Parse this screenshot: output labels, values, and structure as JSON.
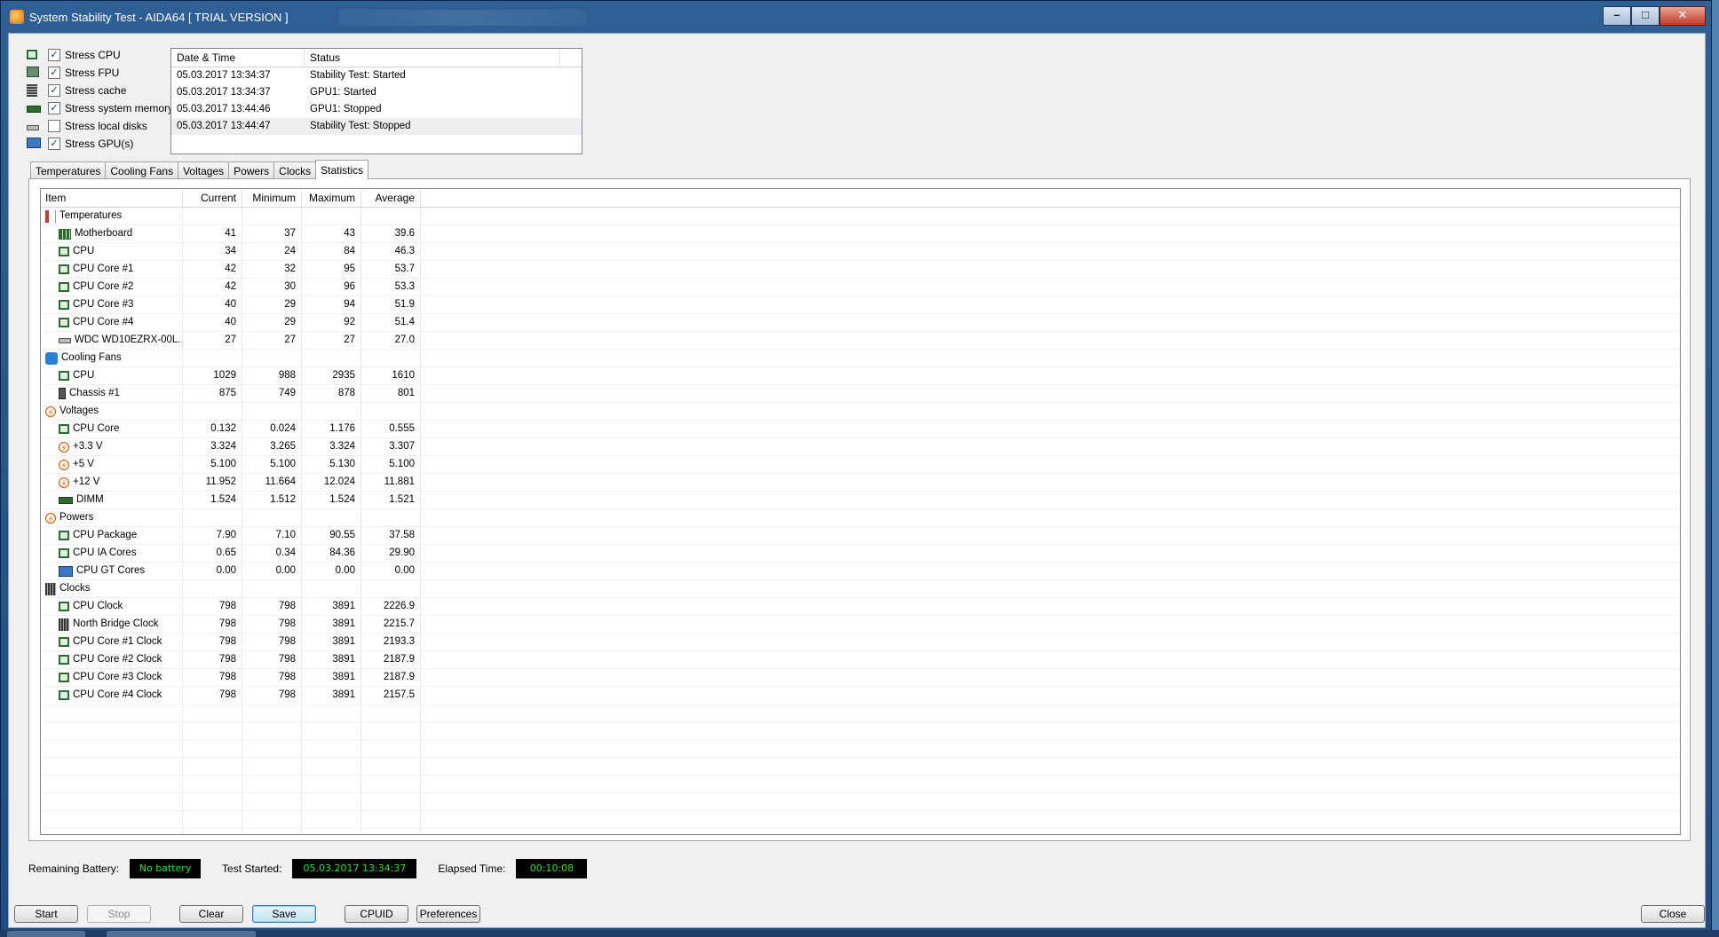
{
  "window": {
    "title": "System Stability Test - AIDA64  [ TRIAL VERSION ]",
    "caption_buttons": {
      "minimize": "–",
      "maximize": "□",
      "close": "✕"
    }
  },
  "stress": [
    {
      "label": "Stress CPU",
      "checked": true,
      "icon": "cpu-chip-icon"
    },
    {
      "label": "Stress FPU",
      "checked": true,
      "icon": "fpu-icon"
    },
    {
      "label": "Stress cache",
      "checked": true,
      "icon": "cache-icon"
    },
    {
      "label": "Stress system memory",
      "checked": true,
      "icon": "memory-icon"
    },
    {
      "label": "Stress local disks",
      "checked": false,
      "icon": "disk-icon"
    },
    {
      "label": "Stress GPU(s)",
      "checked": true,
      "icon": "gpu-icon"
    }
  ],
  "log": {
    "columns": [
      "Date & Time",
      "Status"
    ],
    "rows": [
      {
        "time": "05.03.2017 13:34:37",
        "status": "Stability Test: Started"
      },
      {
        "time": "05.03.2017 13:34:37",
        "status": "GPU1: Started"
      },
      {
        "time": "05.03.2017 13:44:46",
        "status": "GPU1: Stopped"
      },
      {
        "time": "05.03.2017 13:44:47",
        "status": "Stability Test: Stopped"
      }
    ]
  },
  "tabs": [
    "Temperatures",
    "Cooling Fans",
    "Voltages",
    "Powers",
    "Clocks",
    "Statistics"
  ],
  "active_tab": "Statistics",
  "stats": {
    "columns": [
      "Item",
      "Current",
      "Minimum",
      "Maximum",
      "Average"
    ],
    "rows": [
      {
        "type": "group",
        "icon": "thermometer-icon",
        "item": "Temperatures"
      },
      {
        "type": "child",
        "icon": "motherboard-icon",
        "item": "Motherboard",
        "cur": "41",
        "min": "37",
        "max": "43",
        "avg": "39.6"
      },
      {
        "type": "child",
        "icon": "cpu-chip-icon",
        "item": "CPU",
        "cur": "34",
        "min": "24",
        "max": "84",
        "avg": "46.3"
      },
      {
        "type": "child",
        "icon": "cpu-chip-icon",
        "item": "CPU Core #1",
        "cur": "42",
        "min": "32",
        "max": "95",
        "avg": "53.7"
      },
      {
        "type": "child",
        "icon": "cpu-chip-icon",
        "item": "CPU Core #2",
        "cur": "42",
        "min": "30",
        "max": "96",
        "avg": "53.3"
      },
      {
        "type": "child",
        "icon": "cpu-chip-icon",
        "item": "CPU Core #3",
        "cur": "40",
        "min": "29",
        "max": "94",
        "avg": "51.9"
      },
      {
        "type": "child",
        "icon": "cpu-chip-icon",
        "item": "CPU Core #4",
        "cur": "40",
        "min": "29",
        "max": "92",
        "avg": "51.4"
      },
      {
        "type": "child",
        "icon": "disk-icon",
        "item": "WDC WD10EZRX-00L...",
        "cur": "27",
        "min": "27",
        "max": "27",
        "avg": "27.0"
      },
      {
        "type": "group",
        "icon": "fan-icon",
        "item": "Cooling Fans"
      },
      {
        "type": "child",
        "icon": "cpu-chip-icon",
        "item": "CPU",
        "cur": "1029",
        "min": "988",
        "max": "2935",
        "avg": "1610"
      },
      {
        "type": "child",
        "icon": "chassis-icon",
        "item": "Chassis #1",
        "cur": "875",
        "min": "749",
        "max": "878",
        "avg": "801"
      },
      {
        "type": "group",
        "icon": "voltage-icon",
        "item": "Voltages"
      },
      {
        "type": "child",
        "icon": "cpu-chip-icon",
        "item": "CPU Core",
        "cur": "0.132",
        "min": "0.024",
        "max": "1.176",
        "avg": "0.555"
      },
      {
        "type": "child",
        "icon": "voltage-icon",
        "item": "+3.3 V",
        "cur": "3.324",
        "min": "3.265",
        "max": "3.324",
        "avg": "3.307"
      },
      {
        "type": "child",
        "icon": "voltage-icon",
        "item": "+5 V",
        "cur": "5.100",
        "min": "5.100",
        "max": "5.130",
        "avg": "5.100"
      },
      {
        "type": "child",
        "icon": "voltage-icon",
        "item": "+12 V",
        "cur": "11.952",
        "min": "11.664",
        "max": "12.024",
        "avg": "11.881"
      },
      {
        "type": "child",
        "icon": "memory-icon",
        "item": "DIMM",
        "cur": "1.524",
        "min": "1.512",
        "max": "1.524",
        "avg": "1.521"
      },
      {
        "type": "group",
        "icon": "voltage-icon",
        "item": "Powers"
      },
      {
        "type": "child",
        "icon": "cpu-chip-icon",
        "item": "CPU Package",
        "cur": "7.90",
        "min": "7.10",
        "max": "90.55",
        "avg": "37.58"
      },
      {
        "type": "child",
        "icon": "cpu-chip-icon",
        "item": "CPU IA Cores",
        "cur": "0.65",
        "min": "0.34",
        "max": "84.36",
        "avg": "29.90"
      },
      {
        "type": "child",
        "icon": "gpu-icon",
        "item": "CPU GT Cores",
        "cur": "0.00",
        "min": "0.00",
        "max": "0.00",
        "avg": "0.00"
      },
      {
        "type": "group",
        "icon": "clock-icon",
        "item": "Clocks"
      },
      {
        "type": "child",
        "icon": "cpu-chip-icon",
        "item": "CPU Clock",
        "cur": "798",
        "min": "798",
        "max": "3891",
        "avg": "2226.9"
      },
      {
        "type": "child",
        "icon": "clock-icon",
        "item": "North Bridge Clock",
        "cur": "798",
        "min": "798",
        "max": "3891",
        "avg": "2215.7"
      },
      {
        "type": "child",
        "icon": "cpu-chip-icon",
        "item": "CPU Core #1 Clock",
        "cur": "798",
        "min": "798",
        "max": "3891",
        "avg": "2193.3"
      },
      {
        "type": "child",
        "icon": "cpu-chip-icon",
        "item": "CPU Core #2 Clock",
        "cur": "798",
        "min": "798",
        "max": "3891",
        "avg": "2187.9"
      },
      {
        "type": "child",
        "icon": "cpu-chip-icon",
        "item": "CPU Core #3 Clock",
        "cur": "798",
        "min": "798",
        "max": "3891",
        "avg": "2187.9"
      },
      {
        "type": "child",
        "icon": "cpu-chip-icon",
        "item": "CPU Core #4 Clock",
        "cur": "798",
        "min": "798",
        "max": "3891",
        "avg": "2157.5"
      }
    ]
  },
  "statusbar": {
    "battery_label": "Remaining Battery:",
    "battery_value": "No battery",
    "started_label": "Test Started:",
    "started_value": "05.03.2017 13:34:37",
    "elapsed_label": "Elapsed Time:",
    "elapsed_value": "00:10:08",
    "lcd_text_color": "#22e02e"
  },
  "buttons": {
    "start": "Start",
    "stop": "Stop",
    "clear": "Clear",
    "save": "Save",
    "cpuid": "CPUID",
    "preferences": "Preferences",
    "close": "Close"
  }
}
